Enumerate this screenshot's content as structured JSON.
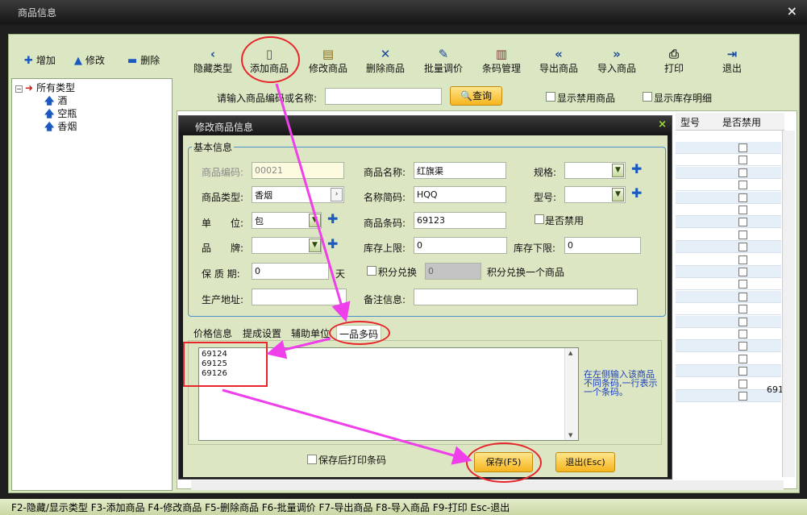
{
  "window": {
    "title": "商品信息",
    "close": "×"
  },
  "toolbar_left": {
    "add": "增加",
    "edit": "修改",
    "delete": "删除"
  },
  "toolbar": {
    "hide_type": "隐藏类型",
    "add_product": "添加商品",
    "edit_product": "修改商品",
    "delete_product": "删除商品",
    "batch_price": "批量调价",
    "barcode_manage": "条码管理",
    "export_product": "导出商品",
    "import_product": "导入商品",
    "print": "打印",
    "exit": "退出"
  },
  "tree": {
    "root": "所有类型",
    "items": [
      "酒",
      "空瓶",
      "香烟"
    ]
  },
  "search": {
    "label": "请输入商品编码或名称:",
    "value": "",
    "button": "查询",
    "show_disabled": "显示禁用商品",
    "show_stock_detail": "显示库存明细"
  },
  "grid": {
    "columns": [
      "型号",
      "是否禁用"
    ],
    "last_value": "691"
  },
  "dialog": {
    "title": "修改商品信息",
    "close": "×",
    "group_title": "基本信息",
    "fields": {
      "code_label": "商品编码:",
      "code_value": "00021",
      "name_label": "商品名称:",
      "name_value": "红旗渠",
      "spec_label": "规格:",
      "spec_value": "",
      "type_label": "商品类型:",
      "type_value": "香烟",
      "abbr_label": "名称简码:",
      "abbr_value": "HQQ",
      "model_label": "型号:",
      "model_value": "",
      "unit_label": "单　　位:",
      "unit_value": "包",
      "barcode_label": "商品条码:",
      "barcode_value": "69123",
      "disabled_label": "是否禁用",
      "brand_label": "品　　牌:",
      "brand_value": "",
      "stock_max_label": "库存上限:",
      "stock_max_value": "0",
      "stock_min_label": "库存下限:",
      "stock_min_value": "0",
      "shelf_label": "保 质 期:",
      "shelf_value": "0",
      "shelf_unit": "天",
      "points_label": "积分兑换",
      "points_value": "0",
      "points_desc": "积分兑换一个商品",
      "address_label": "生产地址:",
      "address_value": "",
      "remark_label": "备注信息:",
      "remark_value": ""
    },
    "tabs": [
      "价格信息",
      "提成设置",
      "辅助单位",
      "一品多码"
    ],
    "barcodes": [
      "69124",
      "69125",
      "69126"
    ],
    "help_text": "在左侧输入该商品不同条码,一行表示一个条码。",
    "print_after_save": "保存后打印条码",
    "save_button": "保存(F5)",
    "exit_button": "退出(Esc)"
  },
  "status_bar": "F2-隐藏/显示类型 F3-添加商品 F4-修改商品 F5-删除商品 F6-批量调价 F7-导出商品 F8-导入商品 F9-打印 Esc-退出",
  "colors": {
    "accent_red": "#e8252a",
    "arrow_magenta": "#ee3fea",
    "button_gold": "#f6b51e",
    "panel_green": "#dbe6c2"
  }
}
